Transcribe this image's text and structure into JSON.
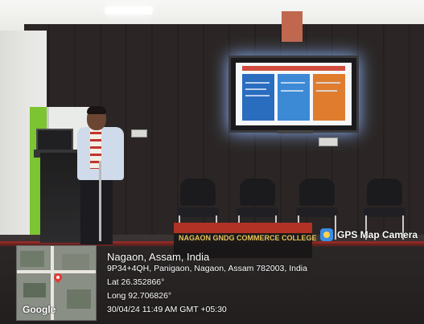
{
  "banner": {
    "text": "NAGAON GNDG COMMERCE COLLEGE"
  },
  "overlay": {
    "brand": "GPS Map Camera",
    "map_label": "Google",
    "location": "Nagaon, Assam, India",
    "address": "9P34+4QH, Panigaon, Nagaon, Assam 782003, India",
    "latitude": "Lat 26.352866°",
    "longitude": "Long 92.706826°",
    "timestamp": "30/04/24 11:49 AM GMT +05:30"
  },
  "icons": {
    "brand_icon": "camera-app-icon",
    "map_pin": "map-pin-icon"
  },
  "colors": {
    "gamosa_red": "#c0352d",
    "banner_gold": "#e8c45a",
    "pin_red": "#e53935"
  }
}
